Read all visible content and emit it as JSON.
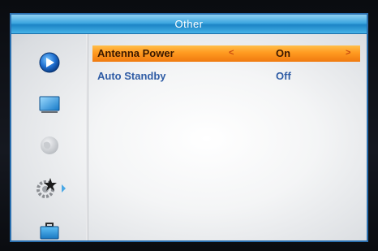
{
  "screen": {
    "title": "Other"
  },
  "sidebar": {
    "items": [
      {
        "icon": "play-icon"
      },
      {
        "icon": "tv-screen-icon"
      },
      {
        "icon": "globe-icon"
      },
      {
        "icon": "settings-gear-icon",
        "active": true
      },
      {
        "icon": "toolbox-icon"
      }
    ]
  },
  "menu": {
    "items": [
      {
        "label": "Antenna Power",
        "value": "On",
        "selected": true
      },
      {
        "label": "Auto Standby",
        "value": "Off",
        "selected": false
      }
    ],
    "left_arrow": "<",
    "right_arrow": ">"
  },
  "colors": {
    "title_bar": "#3ea7e0",
    "highlight": "#ff9a20",
    "menu_text": "#2f5ca5"
  }
}
